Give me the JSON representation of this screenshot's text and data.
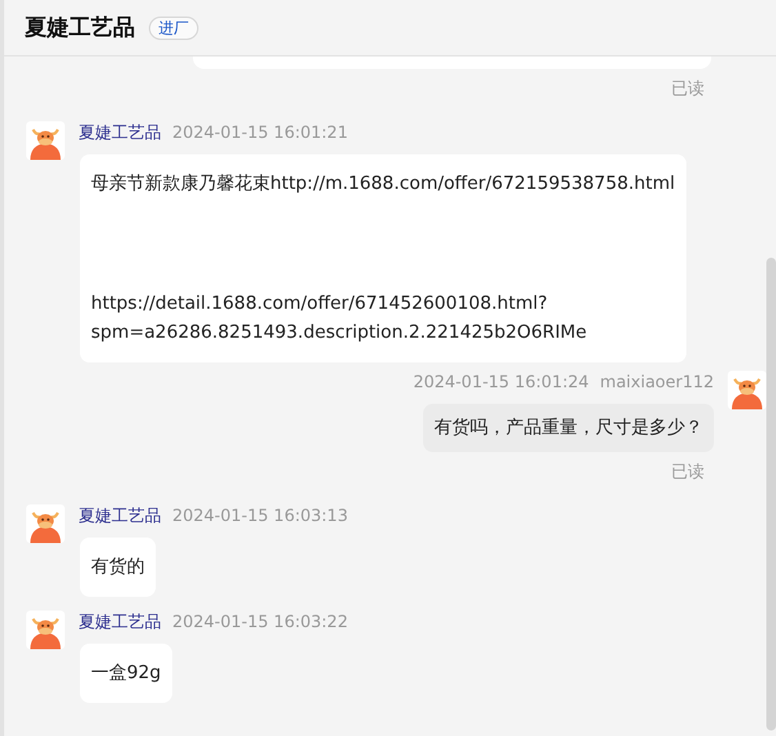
{
  "header": {
    "title": "夏婕工艺品",
    "badge": "进厂"
  },
  "messages": [
    {
      "kind": "cut"
    },
    {
      "kind": "read",
      "text": "已读"
    },
    {
      "kind": "incoming",
      "name": "夏婕工艺品",
      "time": "2024-01-15 16:01:21",
      "paragraphs": [
        {
          "lines": [
            "母亲节新款康乃馨花束http://m.1688.com/offer/672159538758.html"
          ]
        },
        {
          "lines": [
            "https://detail.1688.com/offer/671452600108.html?",
            "spm=a26286.8251493.description.2.221425b2O6RIMe"
          ]
        }
      ]
    },
    {
      "kind": "outgoing",
      "name": "maixiaoer112",
      "time": "2024-01-15 16:01:24",
      "paragraphs": [
        {
          "lines": [
            "有货吗，产品重量，尺寸是多少？"
          ]
        }
      ]
    },
    {
      "kind": "read",
      "text": "已读"
    },
    {
      "kind": "incoming",
      "name": "夏婕工艺品",
      "time": "2024-01-15 16:03:13",
      "paragraphs": [
        {
          "lines": [
            "有货的"
          ]
        }
      ]
    },
    {
      "kind": "incoming",
      "name": "夏婕工艺品",
      "time": "2024-01-15 16:03:22",
      "paragraphs": [
        {
          "lines": [
            "一盒92g"
          ]
        }
      ]
    }
  ]
}
